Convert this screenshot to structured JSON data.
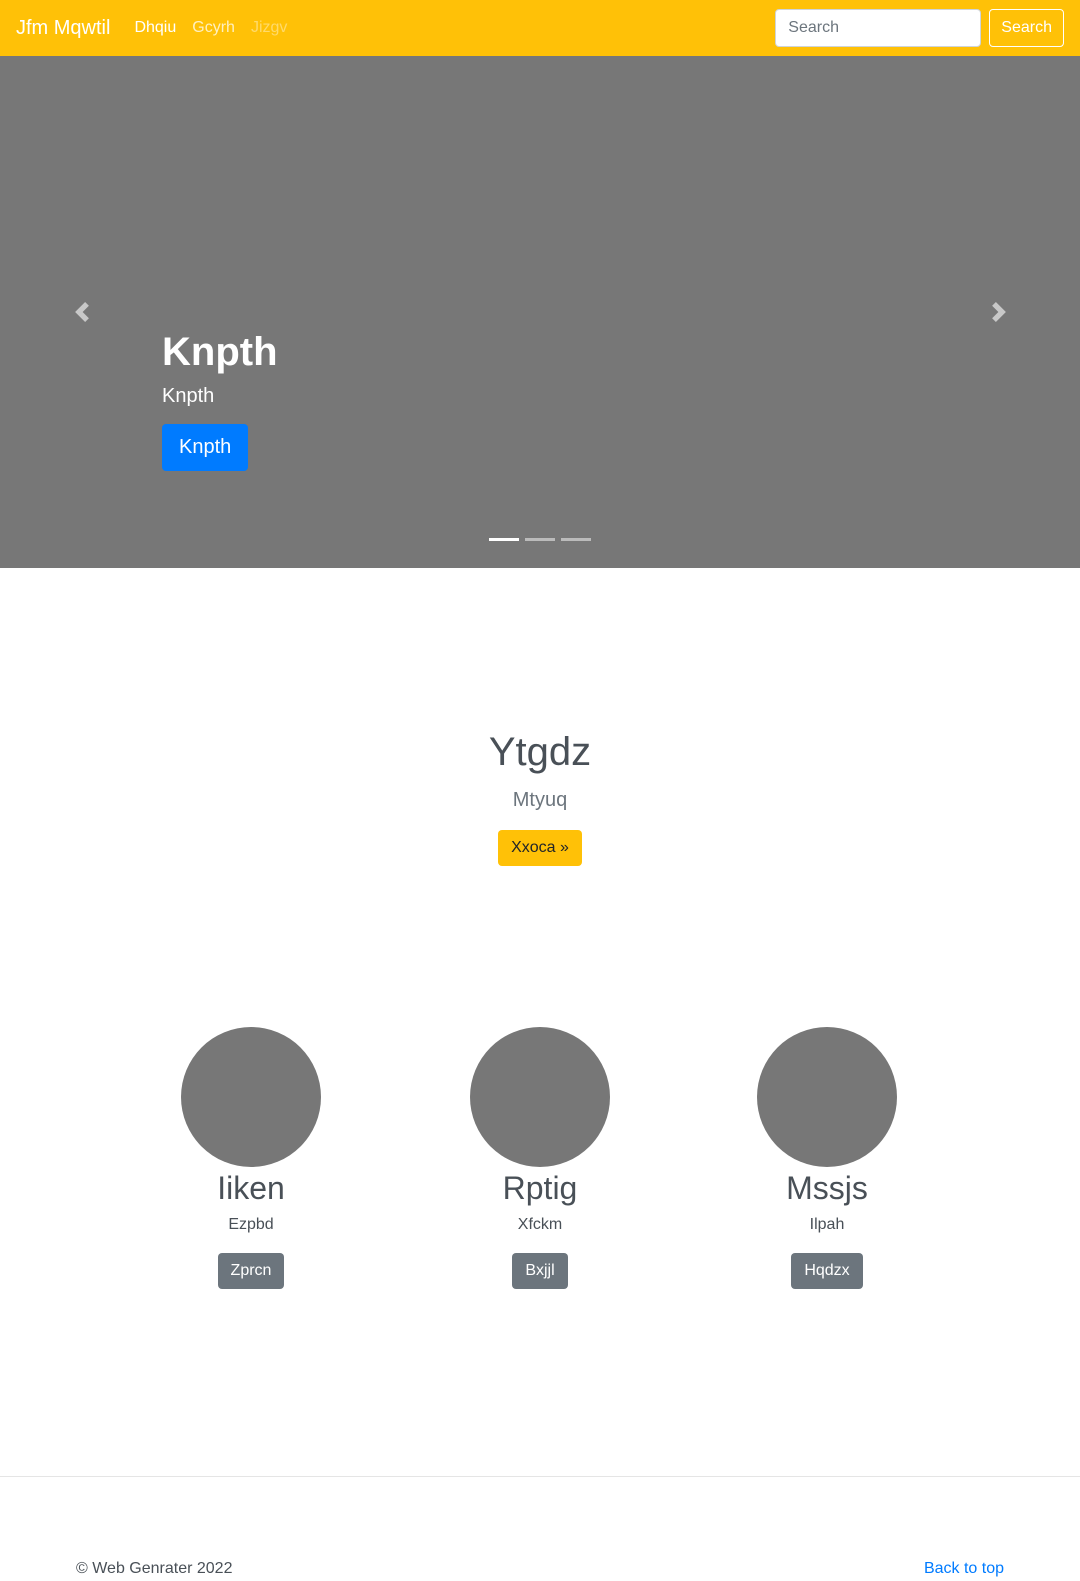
{
  "navbar": {
    "brand": "Jfm Mqwtil",
    "links": [
      {
        "label": "Dhqiu",
        "state": "active"
      },
      {
        "label": "Gcyrh",
        "state": "default"
      },
      {
        "label": "Jizgv",
        "state": "disabled"
      }
    ],
    "search_placeholder": "Search",
    "search_button": "Search"
  },
  "carousel": {
    "slide": {
      "title": "Knpth",
      "text": "Knpth",
      "button": "Knpth"
    },
    "indicator_count": 3,
    "active_indicator": 1
  },
  "jumbo": {
    "title": "Ytgdz",
    "lead": "Mtyuq",
    "button": "Xxoca »"
  },
  "features": [
    {
      "name": "Iiken",
      "sub": "Ezpbd",
      "button": "Zprcn"
    },
    {
      "name": "Rptig",
      "sub": "Xfckm",
      "button": "Bxjjl"
    },
    {
      "name": "Mssjs",
      "sub": "Ilpah",
      "button": "Hqdzx"
    }
  ],
  "footer": {
    "copyright": "© Web Genrater 2022",
    "back_to_top": "Back to top"
  },
  "colors": {
    "navbar": "#ffc107",
    "carousel_bg": "#777777",
    "primary": "#007bff",
    "secondary": "#6c757d",
    "warning": "#ffc107"
  }
}
